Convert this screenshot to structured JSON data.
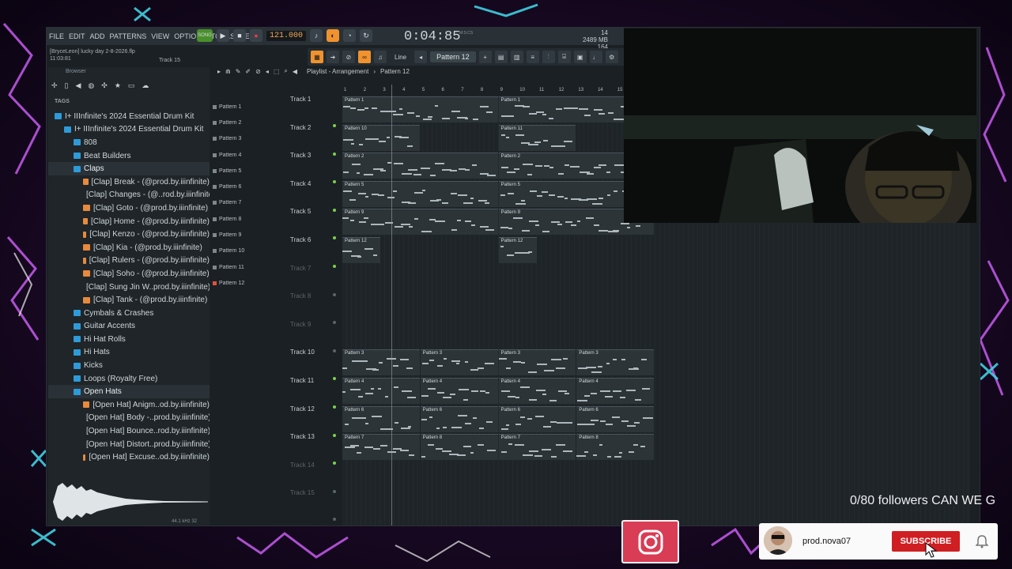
{
  "menu": [
    "FILE",
    "EDIT",
    "ADD",
    "PATTERNS",
    "VIEW",
    "OPTIONS",
    "TOOLS",
    "HELP"
  ],
  "transport": {
    "mode_label": "SONG",
    "tempo": "121.000",
    "time": "0:04:85",
    "time_unit": "M:S:CS",
    "meter_top": "14",
    "meter_mem": "2489 MB",
    "meter_val": "164"
  },
  "project": {
    "user": "[BryceLeon] lucky day 2-8-2026.flp",
    "time": "11:03:81",
    "track_hint": "Track 15"
  },
  "toolbar2": {
    "line_label": "Line",
    "pattern_selector": "Pattern 12"
  },
  "browser": {
    "title": "Browser",
    "tags_label": "TAGS",
    "tree": [
      {
        "label": "I+ IIInfinite's 2024 Essential Drum Kit",
        "kind": "folder",
        "indent": 0
      },
      {
        "label": "I+ IIInfinite's 2024 Essential Drum Kit",
        "kind": "folder",
        "indent": 1
      },
      {
        "label": "808",
        "kind": "folder",
        "indent": 2
      },
      {
        "label": "Beat Builders",
        "kind": "folder",
        "indent": 2
      },
      {
        "label": "Claps",
        "kind": "folder",
        "indent": 2
      },
      {
        "label": "[Clap] Break - (@prod.by.iiinfinite)",
        "kind": "file",
        "indent": 3
      },
      {
        "label": "[Clap] Changes - (@..rod.by.iiinfinite)",
        "kind": "file",
        "indent": 3
      },
      {
        "label": "[Clap] Goto - (@prod.by.iiinfinite)",
        "kind": "file",
        "indent": 3
      },
      {
        "label": "[Clap] Home - (@prod.by.iiinfinite)",
        "kind": "file",
        "indent": 3
      },
      {
        "label": "[Clap] Kenzo - (@prod.by.iiinfinite)",
        "kind": "file",
        "indent": 3
      },
      {
        "label": "[Clap] Kia - (@prod.by.iiinfinite)",
        "kind": "file",
        "indent": 3
      },
      {
        "label": "[Clap] Rulers - (@prod.by.iiinfinite)",
        "kind": "file",
        "indent": 3
      },
      {
        "label": "[Clap] Soho - (@prod.by.iiinfinite)",
        "kind": "file",
        "indent": 3
      },
      {
        "label": "[Clap] Sung Jin W..prod.by.iiinfinite)",
        "kind": "file",
        "indent": 3
      },
      {
        "label": "[Clap] Tank - (@prod.by.iiinfinite)",
        "kind": "file",
        "indent": 3
      },
      {
        "label": "Cymbals & Crashes",
        "kind": "folder",
        "indent": 2
      },
      {
        "label": "Guitar Accents",
        "kind": "folder",
        "indent": 2
      },
      {
        "label": "Hi Hat Rolls",
        "kind": "folder",
        "indent": 2
      },
      {
        "label": "Hi Hats",
        "kind": "folder",
        "indent": 2
      },
      {
        "label": "Kicks",
        "kind": "folder",
        "indent": 2
      },
      {
        "label": "Loops (Royalty Free)",
        "kind": "folder",
        "indent": 2
      },
      {
        "label": "Open Hats",
        "kind": "folder",
        "indent": 2
      },
      {
        "label": "[Open Hat] Anigm..od.by.iiinfinite)",
        "kind": "file",
        "indent": 3
      },
      {
        "label": "[Open Hat] Body -..prod.by.iiinfinite)",
        "kind": "file",
        "indent": 3
      },
      {
        "label": "[Open Hat] Bounce..rod.by.iiinfinite)",
        "kind": "file",
        "indent": 3
      },
      {
        "label": "[Open Hat] Distort..prod.by.iiinfinite)",
        "kind": "file",
        "indent": 3
      },
      {
        "label": "[Open Hat] Excuse..od.by.iiinfinite)",
        "kind": "file",
        "indent": 3
      }
    ],
    "wave_info": "44.1 kHz 32"
  },
  "patterns": [
    "Pattern 1",
    "Pattern 2",
    "Pattern 3",
    "Pattern 4",
    "Pattern 5",
    "Pattern 6",
    "Pattern 7",
    "Pattern 8",
    "Pattern 9",
    "Pattern 10",
    "Pattern 11",
    "Pattern 12"
  ],
  "playlist": {
    "title": "Playlist - Arrangement",
    "current_pattern": "Pattern 12",
    "ruler": [
      "1",
      "2",
      "3",
      "4",
      "5",
      "6",
      "7",
      "8",
      "9",
      "10",
      "11",
      "12",
      "13",
      "14",
      "15"
    ],
    "tracks": [
      {
        "label": "Track 1",
        "active": true
      },
      {
        "label": "Track 2",
        "active": true
      },
      {
        "label": "Track 3",
        "active": true
      },
      {
        "label": "Track 4",
        "active": true
      },
      {
        "label": "Track 5",
        "active": true
      },
      {
        "label": "Track 6",
        "active": true
      },
      {
        "label": "Track 7",
        "active": false
      },
      {
        "label": "Track 8",
        "active": false
      },
      {
        "label": "Track 9",
        "active": false
      },
      {
        "label": "Track 10",
        "active": true
      },
      {
        "label": "Track 11",
        "active": true
      },
      {
        "label": "Track 12",
        "active": true
      },
      {
        "label": "Track 13",
        "active": true
      },
      {
        "label": "Track 14",
        "active": false
      },
      {
        "label": "Track 15",
        "active": false
      }
    ],
    "clips": [
      {
        "track": 0,
        "bar": 1,
        "len": 8,
        "name": "Pattern 1"
      },
      {
        "track": 0,
        "bar": 9,
        "len": 6.6,
        "name": "Pattern 1"
      },
      {
        "track": 1,
        "bar": 1,
        "len": 4,
        "name": "Pattern 10"
      },
      {
        "track": 1,
        "bar": 9,
        "len": 4,
        "name": "Pattern 11"
      },
      {
        "track": 2,
        "bar": 1,
        "len": 8,
        "name": "Pattern 2"
      },
      {
        "track": 2,
        "bar": 9,
        "len": 6.6,
        "name": "Pattern 2"
      },
      {
        "track": 3,
        "bar": 1,
        "len": 8,
        "name": "Pattern 5"
      },
      {
        "track": 3,
        "bar": 9,
        "len": 6.6,
        "name": "Pattern 5"
      },
      {
        "track": 4,
        "bar": 1,
        "len": 8,
        "name": "Pattern 9"
      },
      {
        "track": 4,
        "bar": 9,
        "len": 8,
        "name": "Pattern 9"
      },
      {
        "track": 5,
        "bar": 1,
        "len": 2,
        "name": "Pattern 12"
      },
      {
        "track": 5,
        "bar": 9,
        "len": 2,
        "name": "Pattern 12"
      },
      {
        "track": 9,
        "bar": 1,
        "len": 4,
        "name": "Pattern 3"
      },
      {
        "track": 9,
        "bar": 5,
        "len": 4,
        "name": "Pattern 3"
      },
      {
        "track": 9,
        "bar": 9,
        "len": 4,
        "name": "Pattern 3"
      },
      {
        "track": 9,
        "bar": 13,
        "len": 4,
        "name": "Pattern 3"
      },
      {
        "track": 10,
        "bar": 1,
        "len": 4,
        "name": "Pattern 4"
      },
      {
        "track": 10,
        "bar": 5,
        "len": 4,
        "name": "Pattern 4"
      },
      {
        "track": 10,
        "bar": 9,
        "len": 4,
        "name": "Pattern 4"
      },
      {
        "track": 10,
        "bar": 13,
        "len": 4,
        "name": "Pattern 4"
      },
      {
        "track": 11,
        "bar": 1,
        "len": 4,
        "name": "Pattern 6"
      },
      {
        "track": 11,
        "bar": 5,
        "len": 4,
        "name": "Pattern 6"
      },
      {
        "track": 11,
        "bar": 9,
        "len": 4,
        "name": "Pattern 6"
      },
      {
        "track": 11,
        "bar": 13,
        "len": 4,
        "name": "Pattern 6"
      },
      {
        "track": 12,
        "bar": 1,
        "len": 4,
        "name": "Pattern 7"
      },
      {
        "track": 12,
        "bar": 5,
        "len": 4,
        "name": "Pattern 8"
      },
      {
        "track": 12,
        "bar": 9,
        "len": 4,
        "name": "Pattern 7"
      },
      {
        "track": 12,
        "bar": 13,
        "len": 4,
        "name": "Pattern 8"
      }
    ]
  },
  "overlay": {
    "followers_text": "0/80 followers CAN WE G",
    "channel_name": "prod.nova07",
    "subscribe_label": "SUBSCRIBE"
  },
  "colors": {
    "accent": "#f0922e",
    "note": "#aeb7bb",
    "subscribe": "#cf1f22",
    "instagram": "#d93c55"
  }
}
